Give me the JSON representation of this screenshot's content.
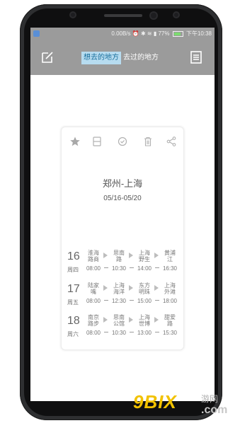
{
  "status_bar": {
    "speed": "0.00B/s",
    "battery": "77%",
    "time": "下午10:38"
  },
  "app_bar": {
    "tabs": [
      {
        "label": "想去的地方",
        "active": true
      },
      {
        "label": "去过的地方",
        "active": false
      }
    ]
  },
  "card": {
    "toolbar_icons": [
      "star-icon",
      "layout-icon",
      "check-circle-icon",
      "trash-icon",
      "share-icon"
    ],
    "title": "郑州-上海",
    "dates": "05/16-05/20",
    "days": [
      {
        "date": "16",
        "weekday": "周四",
        "stops": [
          {
            "name": "淮海\n路商",
            "time": "08:00"
          },
          {
            "name": "思南\n路",
            "time": "10:30"
          },
          {
            "name": "上海\n野生",
            "time": "14:00"
          },
          {
            "name": "黄浦\n江",
            "time": "16:30"
          }
        ]
      },
      {
        "date": "17",
        "weekday": "周五",
        "stops": [
          {
            "name": "陆家\n嘴",
            "time": "08:00"
          },
          {
            "name": "上海\n海洋",
            "time": "12:30"
          },
          {
            "name": "东方\n明珠",
            "time": "15:00"
          },
          {
            "name": "上海\n外滩",
            "time": "18:00"
          }
        ]
      },
      {
        "date": "18",
        "weekday": "周六",
        "stops": [
          {
            "name": "南京\n路步",
            "time": "08:00"
          },
          {
            "name": "思南\n公馆",
            "time": "10:30"
          },
          {
            "name": "上海\n世博",
            "time": "13:00"
          },
          {
            "name": "甜爱\n路",
            "time": "15:30"
          }
        ]
      }
    ]
  },
  "watermark": {
    "brand": "9BIX",
    "site_cn": "游网",
    "site_com": ".com"
  },
  "colors": {
    "app_bar": "#9b9b9b",
    "tab_active_bg": "#b7dcf0",
    "tab_active_text": "#1a6f9c"
  }
}
